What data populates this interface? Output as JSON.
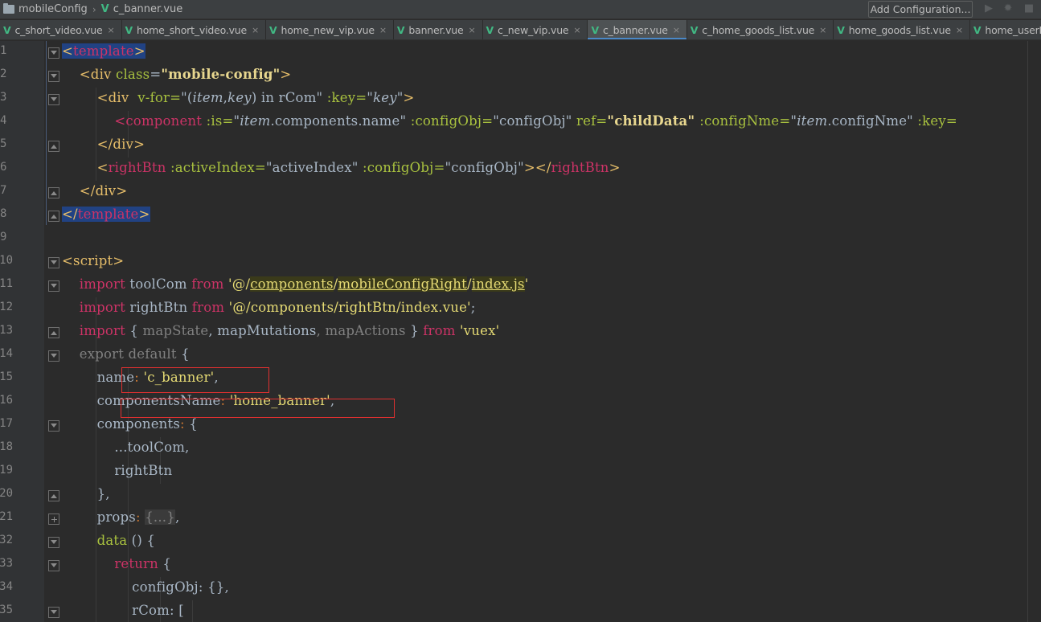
{
  "navbar": {
    "project": "mobileConfig",
    "file": "c_banner.vue",
    "config_button": "Add Configuration...",
    "icons": [
      "run-icon",
      "debug-icon",
      "stop-icon"
    ]
  },
  "tabs": [
    {
      "label": "c_short_video.vue",
      "active": false
    },
    {
      "label": "home_short_video.vue",
      "active": false
    },
    {
      "label": "home_new_vip.vue",
      "active": false
    },
    {
      "label": "banner.vue",
      "active": false
    },
    {
      "label": "c_new_vip.vue",
      "active": false
    },
    {
      "label": "c_banner.vue",
      "active": true
    },
    {
      "label": "c_home_goods_list.vue",
      "active": false
    },
    {
      "label": "home_goods_list.vue",
      "active": false
    },
    {
      "label": "home_userInfo",
      "active": false
    }
  ],
  "editor": {
    "lines": [
      {
        "n": "1"
      },
      {
        "n": "2"
      },
      {
        "n": "3"
      },
      {
        "n": "4"
      },
      {
        "n": "5"
      },
      {
        "n": "6"
      },
      {
        "n": "7"
      },
      {
        "n": "8"
      },
      {
        "n": "9"
      },
      {
        "n": "10"
      },
      {
        "n": "11"
      },
      {
        "n": "12"
      },
      {
        "n": "13"
      },
      {
        "n": "14"
      },
      {
        "n": "15"
      },
      {
        "n": "16"
      },
      {
        "n": "17"
      },
      {
        "n": "18"
      },
      {
        "n": "19"
      },
      {
        "n": "20"
      },
      {
        "n": "21"
      },
      {
        "n": "32"
      },
      {
        "n": "33"
      },
      {
        "n": "34"
      },
      {
        "n": "35"
      }
    ],
    "code": {
      "l1_tag": "template",
      "l2_attr": "class",
      "l2_val": "mobile-config",
      "l3_vfor": "v-for=",
      "l3_item": "item",
      "l3_key": "key",
      "l3_in": " in rCom",
      "l3_keyattr": ":key=",
      "l4_is": ":is=",
      "l4_comp": ".components.name",
      "l4_cfg": ":configObj=",
      "l4_cfgval": "configObj",
      "l4_ref": "ref=",
      "l4_refval": "childData",
      "l4_nme": ":configNme=",
      "l4_nmeval": ".configNme",
      "l4_key": ":key=",
      "l6_tag": "rightBtn",
      "l6_ai": ":activeIndex=",
      "l6_aival": "activeIndex",
      "l6_cfg": ":configObj=",
      "l6_cfgval": "configObj",
      "l11_import": "import",
      "l11_name": "toolCom",
      "l11_from": "from",
      "l11_p1": "components",
      "l11_p2": "mobileConfigRight",
      "l11_p3": "index.js",
      "l12_name": "rightBtn",
      "l12_path": "'@/components/rightBtn/index.vue'",
      "l13_ms": "mapState",
      "l13_mm": "mapMutations",
      "l13_ma": "mapActions",
      "l13_path": "'vuex'",
      "l14_export": "export default",
      "l15_key": "name",
      "l15_val": "'c_banner'",
      "l16_key": "componentsName",
      "l16_val": "'home_banner'",
      "l17_key": "components",
      "l18_val": "...toolCom,",
      "l19_val": "rightBtn",
      "l21_key": "props",
      "l21_fold": "{...}",
      "l32_key": "data",
      "l33_kw": "return",
      "l34_key": "configObj",
      "l35_key": "rCom"
    }
  }
}
